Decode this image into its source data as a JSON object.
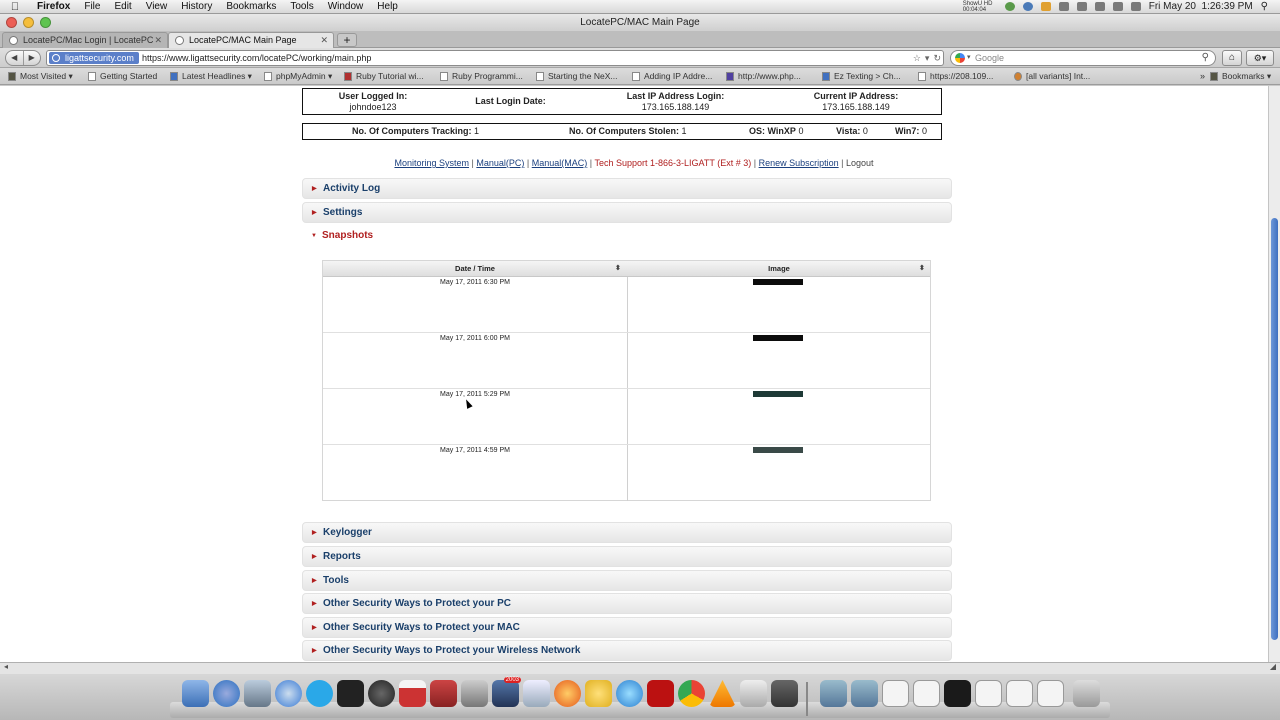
{
  "menubar": {
    "app": "Firefox",
    "items": [
      "File",
      "Edit",
      "View",
      "History",
      "Bookmarks",
      "Tools",
      "Window",
      "Help"
    ],
    "clock": "Fri May 20  1:26:39 PM",
    "tray_text": "ShowU HD 00:04:04"
  },
  "window": {
    "title": "LocatePC/MAC Main Page"
  },
  "tabs": [
    {
      "label": "LocatePC/Mac Login | LocatePC"
    },
    {
      "label": "LocatePC/MAC Main Page"
    }
  ],
  "newtab_label": "+",
  "navbar": {
    "site_badge": "ligattsecurity.com",
    "url": "https://www.ligattsecurity.com/locatePC/working/main.php",
    "search_placeholder": "Google",
    "back_glyph": "◀",
    "forward_glyph": "▶"
  },
  "bookmarks": [
    {
      "label": "Most Visited ▾"
    },
    {
      "label": "Getting Started"
    },
    {
      "label": "Latest Headlines ▾"
    },
    {
      "label": "phpMyAdmin ▾"
    },
    {
      "label": "Ruby Tutorial wi..."
    },
    {
      "label": "Ruby Programmi..."
    },
    {
      "label": "Starting the NeX..."
    },
    {
      "label": "Adding IP Addre..."
    },
    {
      "label": "http://www.php..."
    },
    {
      "label": "Ez Texting > Ch..."
    },
    {
      "label": "https://208.109..."
    },
    {
      "label": "[all variants] Int..."
    }
  ],
  "bookmarks_more": "»",
  "bookmarks_menu": "Bookmarks ▾",
  "page": {
    "info": {
      "user_label": "User Logged In:",
      "user_value": "johndoe123",
      "last_login_label": "Last Login Date:",
      "last_ip_label": "Last IP Address Login:",
      "last_ip_value": "173.165.188.149",
      "current_ip_label": "Current IP Address:",
      "current_ip_value": "173.165.188.149"
    },
    "stats": {
      "tracking_label": "No. Of Computers Tracking:",
      "tracking_value": "1",
      "stolen_label": "No. Of Computers Stolen:",
      "stolen_value": "1",
      "winxp_label": "OS: WinXP",
      "winxp_value": "0",
      "vista_label": "Vista:",
      "vista_value": "0",
      "win7_label": "Win7:",
      "win7_value": "0"
    },
    "links": {
      "monitoring": "Monitoring System",
      "manual_pc": "Manual(PC)",
      "manual_mac": "Manual(MAC)",
      "support": "Tech Support 1-866-3-LIGATT (Ext # 3)",
      "renew": "Renew Subscription",
      "logout": "Logout",
      "sep": "|"
    },
    "sections": {
      "activity": "Activity Log",
      "settings": "Settings",
      "snapshots": "Snapshots",
      "keylogger": "Keylogger",
      "reports": "Reports",
      "tools": "Tools",
      "protect_pc": "Other Security Ways to Protect your PC",
      "protect_mac": "Other Security Ways to Protect your MAC",
      "protect_wireless": "Other Security Ways to Protect your Wireless Network"
    },
    "snapshots_table": {
      "headers": {
        "datetime": "Date / Time",
        "image": "Image"
      },
      "rows": [
        {
          "datetime": "May 17, 2011 6:30 PM"
        },
        {
          "datetime": "May 17, 2011 6:00 PM"
        },
        {
          "datetime": "May 17, 2011 5:29 PM"
        },
        {
          "datetime": "May 17, 2011 4:59 PM"
        }
      ]
    }
  },
  "dock_badge": "2003",
  "colors": {
    "link": "#1a3f7e",
    "accent_red": "#b02020",
    "section_title": "#1a3f6a",
    "site_badge": "#5b7fc9"
  }
}
